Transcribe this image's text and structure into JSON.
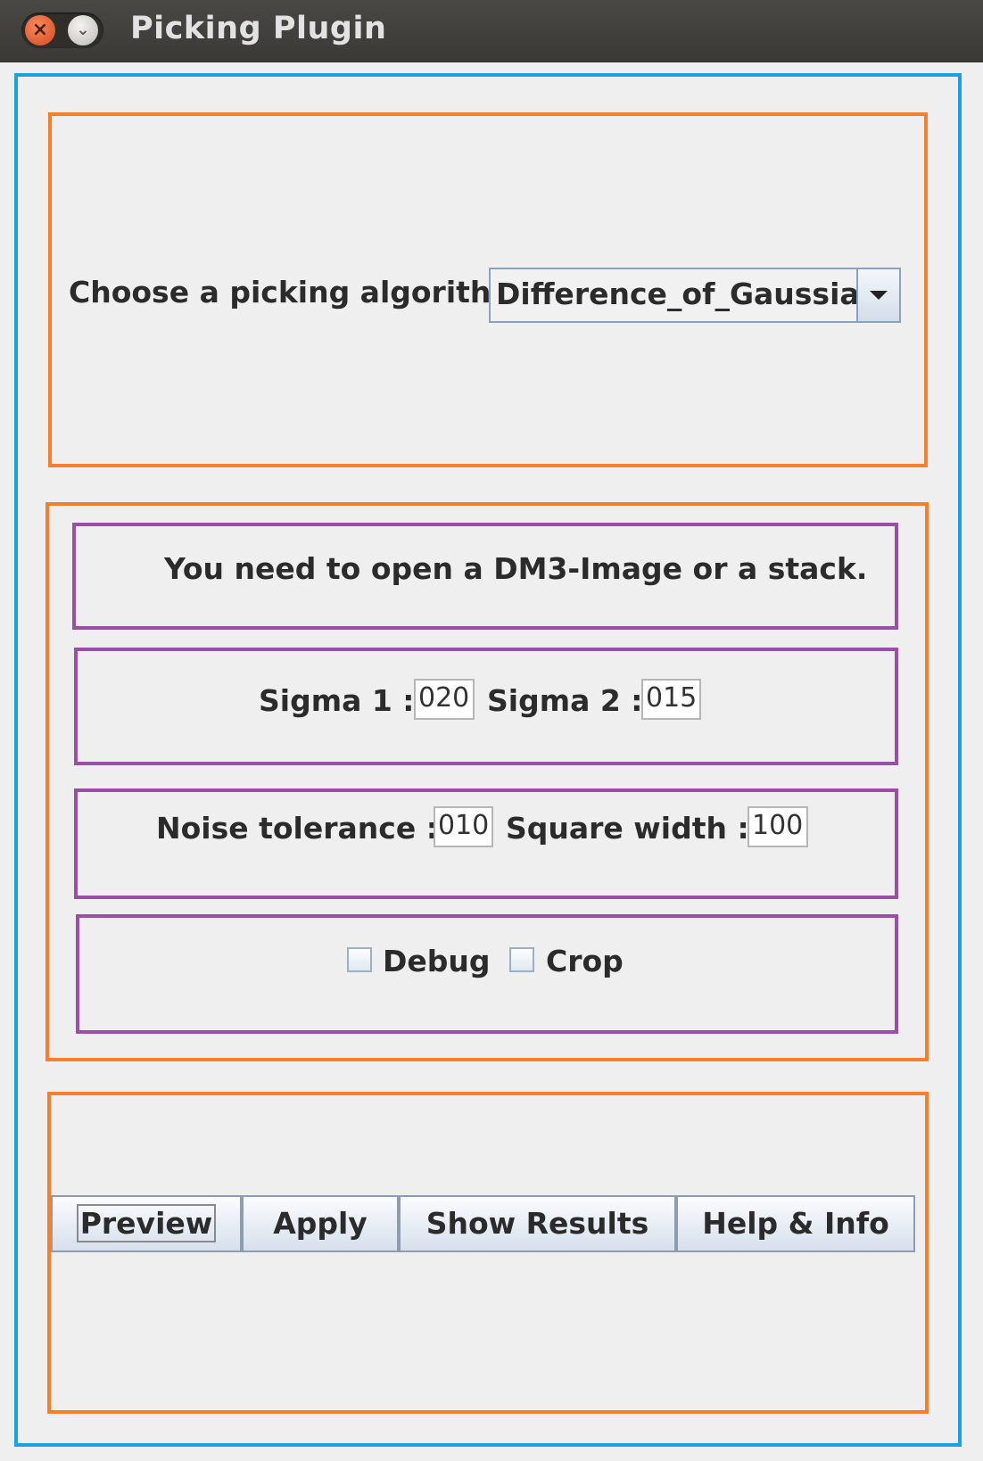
{
  "window": {
    "title": "Picking Plugin"
  },
  "algorithm": {
    "label": "Choose a picking algorithm",
    "selected": "Difference_of_Gaussian"
  },
  "status": {
    "message": "You need to open a DM3-Image or a stack."
  },
  "sigma": {
    "sigma1_label": "Sigma 1 :",
    "sigma1_value": "020",
    "sigma2_label": "Sigma 2 :",
    "sigma2_value": "015"
  },
  "noise": {
    "noise_label": "Noise tolerance :",
    "noise_value": "010",
    "square_label": "Square width :",
    "square_value": "100"
  },
  "options": {
    "debug_label": "Debug",
    "debug_checked": false,
    "crop_label": "Crop",
    "crop_checked": false
  },
  "buttons": {
    "preview": "Preview",
    "apply": "Apply",
    "show_results": "Show Results",
    "help_info": "Help & Info"
  },
  "icons": {
    "close": "close-icon",
    "minimize": "minimize-icon",
    "dropdown": "chevron-down-icon"
  }
}
